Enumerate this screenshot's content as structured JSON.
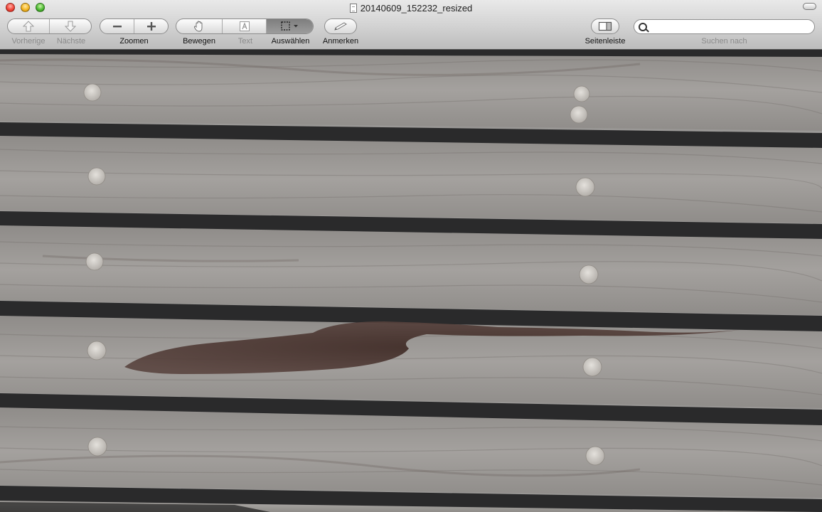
{
  "window": {
    "title": "20140609_152232_resized"
  },
  "toolbar": {
    "prev_label": "Vorherige",
    "next_label": "Nächste",
    "zoom_label": "Zoomen",
    "move_label": "Bewegen",
    "text_label": "Text",
    "select_label": "Auswählen",
    "annotate_label": "Anmerken",
    "sidebar_label": "Seitenleiste",
    "search_label": "Suchen nach"
  },
  "search": {
    "value": ""
  },
  "icons": {
    "close": "close-icon",
    "minimize": "minimize-icon",
    "zoom_window": "zoom-window-icon",
    "prev": "arrow-up-icon",
    "next": "arrow-down-icon",
    "zoom_out": "minus-icon",
    "zoom_in": "plus-icon",
    "move": "hand-icon",
    "text": "text-tool-icon",
    "select": "marquee-select-icon",
    "annotate": "pencil-icon",
    "sidebar": "sidebar-icon",
    "search": "search-icon"
  },
  "colors": {
    "close": "#f2473a",
    "minimize": "#f5b724",
    "zoom": "#4fbb34"
  }
}
